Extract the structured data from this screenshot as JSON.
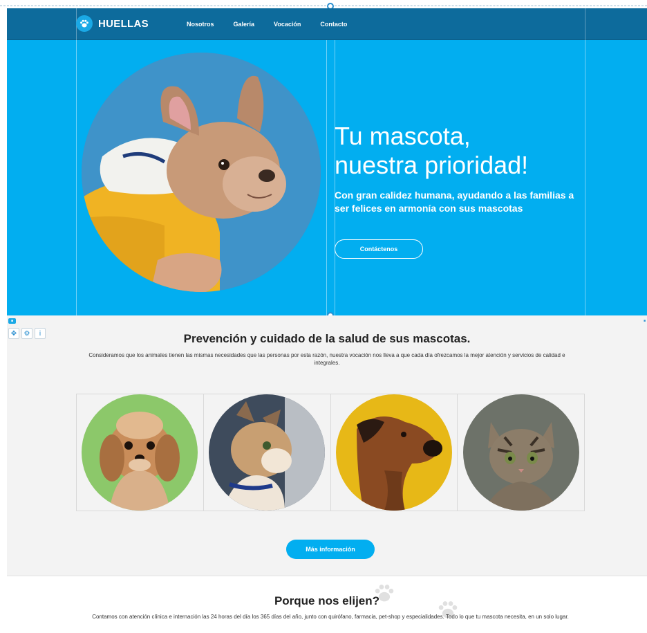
{
  "brand": {
    "name": "HUELLAS",
    "logo_icon": "paw-icon"
  },
  "nav": {
    "items": [
      {
        "label": "Nosotros"
      },
      {
        "label": "Galería"
      },
      {
        "label": "Vocación"
      },
      {
        "label": "Contacto"
      }
    ]
  },
  "hero": {
    "title_line1": "Tu mascota,",
    "title_line2": "nuestra prioridad!",
    "subtitle": "Con gran calidez humana, ayudando a las familias a ser felices en armonía con sus mascotas",
    "cta_label": "Contáctenos",
    "photo": "french-bulldog-photo"
  },
  "section2": {
    "title": "Prevención y cuidado de la salud de sus mascotas.",
    "text": "Consideramos que los animales tienen las mismas necesidades que las personas por esta razón, nuestra vocación nos lleva a que cada día ofrezcamos la mejor atención y servicios de calidad e integrales.",
    "cards": [
      {
        "photo": "maltipoo-dog-photo"
      },
      {
        "photo": "cat-profile-photo"
      },
      {
        "photo": "boxer-dog-photo"
      },
      {
        "photo": "tabby-kitten-photo"
      }
    ],
    "button_label": "Más información"
  },
  "section3": {
    "title": "Porque nos elijen?",
    "text": "Contamos con atención clínica e internación las 24 horas del día los 365 días del año, junto con quirófano, farmacia, pet-shop y especialidades. Todo lo que tu mascota necesita, en un solo lugar."
  },
  "colors": {
    "header": "#0d6b9c",
    "hero": "#02aef0",
    "section_bg": "#f3f3f3",
    "button": "#02aef0"
  }
}
